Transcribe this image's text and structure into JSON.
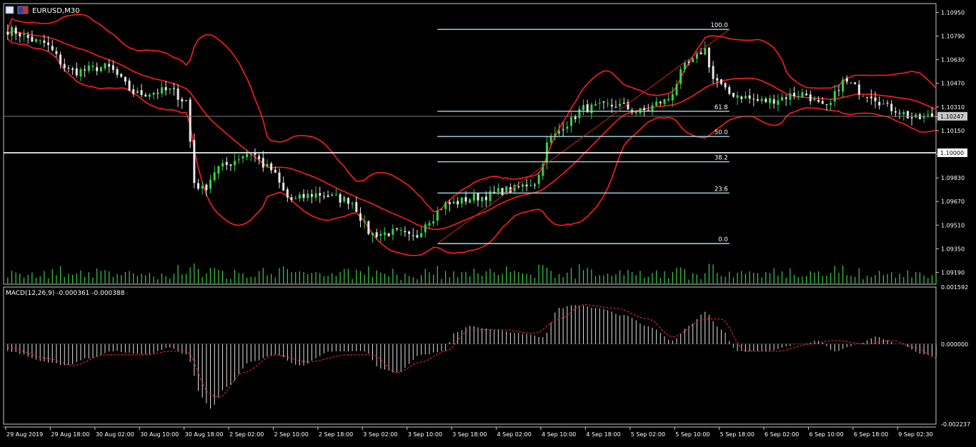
{
  "window": {
    "title": "EURUSD,M30"
  },
  "colors": {
    "background": "#000000",
    "frame": "#c8c8c8",
    "candle_up": "#36d24a",
    "candle_down": "#e8e8e8",
    "bollinger": "#ff1c1c",
    "fibo_line": "#a6dbe6",
    "fibo_trend": "#cc2222",
    "macd_hist": "#e2e2e2",
    "macd_signal": "#ff2a2a",
    "volume": "#36d24a",
    "price_label_bg": "#c8c8c8",
    "text": "#ffffff"
  },
  "chart_data": [
    {
      "type": "candlestick",
      "name": "price",
      "title": "EURUSD,M30",
      "ylim": [
        1.0911,
        1.1101
      ],
      "y_ticks": [
        "1.10950",
        "1.10790",
        "1.10630",
        "1.10470",
        "1.10310",
        "1.10150",
        "1.09990",
        "1.09830",
        "1.09670",
        "1.09510",
        "1.09350",
        "1.09190"
      ],
      "bars": 230,
      "x_ticks": [
        "29 Aug 2019",
        "29 Aug 18:00",
        "30 Aug 02:00",
        "30 Aug 10:00",
        "30 Aug 18:00",
        "2 Sep 02:00",
        "2 Sep 10:00",
        "2 Sep 18:00",
        "3 Sep 02:00",
        "3 Sep 10:00",
        "3 Sep 18:00",
        "4 Sep 02:00",
        "4 Sep 10:00",
        "4 Sep 18:00",
        "5 Sep 02:00",
        "5 Sep 10:00",
        "5 Sep 18:00",
        "6 Sep 02:00",
        "6 Sep 10:00",
        "6 Sep 18:00",
        "9 Sep 02:30"
      ],
      "x_tick_bars": [
        0,
        11,
        22,
        33,
        44,
        55,
        66,
        77,
        88,
        99,
        110,
        121,
        132,
        143,
        154,
        165,
        176,
        187,
        198,
        209,
        220
      ],
      "close_anchors": [
        [
          0,
          1.1083
        ],
        [
          8,
          1.1075
        ],
        [
          16,
          1.1055
        ],
        [
          24,
          1.1058
        ],
        [
          32,
          1.104
        ],
        [
          40,
          1.1042
        ],
        [
          44,
          1.1035
        ],
        [
          46,
          1.098
        ],
        [
          48,
          1.0975
        ],
        [
          52,
          1.099
        ],
        [
          60,
          1.1
        ],
        [
          64,
          1.099
        ],
        [
          70,
          1.0968
        ],
        [
          76,
          1.0972
        ],
        [
          84,
          1.0968
        ],
        [
          90,
          1.0945
        ],
        [
          96,
          1.0946
        ],
        [
          100,
          1.0942
        ],
        [
          104,
          1.0955
        ],
        [
          108,
          1.0965
        ],
        [
          116,
          1.097
        ],
        [
          124,
          1.0975
        ],
        [
          130,
          1.098
        ],
        [
          134,
          1.101
        ],
        [
          138,
          1.102
        ],
        [
          142,
          1.103
        ],
        [
          150,
          1.1032
        ],
        [
          156,
          1.1028
        ],
        [
          162,
          1.1035
        ],
        [
          168,
          1.106
        ],
        [
          172,
          1.107
        ],
        [
          174,
          1.105
        ],
        [
          178,
          1.104
        ],
        [
          186,
          1.1035
        ],
        [
          196,
          1.104
        ],
        [
          202,
          1.103
        ],
        [
          206,
          1.1048
        ],
        [
          212,
          1.104
        ],
        [
          218,
          1.103
        ],
        [
          224,
          1.1023
        ],
        [
          229,
          1.1025
        ]
      ],
      "current_price": "1.10247",
      "level_line": {
        "value": 1.1,
        "label": "1.10000"
      },
      "fibonacci": {
        "high": 1.10835,
        "low": 1.09385,
        "start_bar": 106,
        "end_bar": 178,
        "levels": [
          {
            "ratio": 1.0,
            "label": "100.0"
          },
          {
            "ratio": 0.618,
            "label": "61.8"
          },
          {
            "ratio": 0.5,
            "label": "50.0"
          },
          {
            "ratio": 0.382,
            "label": "38.2"
          },
          {
            "ratio": 0.236,
            "label": "23.6"
          },
          {
            "ratio": 0.0,
            "label": "0.0"
          }
        ]
      },
      "bollinger": {
        "period": 20,
        "deviation": 2
      }
    },
    {
      "type": "bar",
      "name": "macd",
      "title": "MACD(12,26,9) -0.000361 -0.000388",
      "ylim": [
        -0.002237,
        0.001592
      ],
      "y_ticks": [
        "0.001592",
        "0.000000",
        "-0.002237"
      ],
      "hist_anchors": [
        [
          0,
          -0.0002
        ],
        [
          10,
          -0.0005
        ],
        [
          14,
          -0.0006
        ],
        [
          20,
          -0.0004
        ],
        [
          26,
          -0.0002
        ],
        [
          34,
          -0.0003
        ],
        [
          40,
          -0.0001
        ],
        [
          44,
          -0.0003
        ],
        [
          48,
          -0.0015
        ],
        [
          50,
          -0.0018
        ],
        [
          54,
          -0.0012
        ],
        [
          60,
          -0.0005
        ],
        [
          66,
          -0.0003
        ],
        [
          72,
          -0.0006
        ],
        [
          80,
          -0.0002
        ],
        [
          88,
          -0.0002
        ],
        [
          92,
          -0.0007
        ],
        [
          96,
          -0.0008
        ],
        [
          102,
          -0.0003
        ],
        [
          108,
          -0.0002
        ],
        [
          110,
          0.0003
        ],
        [
          114,
          0.0005
        ],
        [
          120,
          0.0004
        ],
        [
          126,
          0.0003
        ],
        [
          132,
          0.0002
        ],
        [
          136,
          0.001
        ],
        [
          140,
          0.0011
        ],
        [
          146,
          0.001
        ],
        [
          152,
          0.0008
        ],
        [
          158,
          0.0005
        ],
        [
          164,
          0.0001
        ],
        [
          168,
          0.0005
        ],
        [
          172,
          0.0009
        ],
        [
          176,
          0.0004
        ],
        [
          180,
          -0.0002
        ],
        [
          186,
          -0.0002
        ],
        [
          196,
          0.0
        ],
        [
          200,
          0.0001
        ],
        [
          204,
          -0.0002
        ],
        [
          210,
          0.0
        ],
        [
          214,
          0.0002
        ],
        [
          220,
          0.0
        ],
        [
          226,
          -0.0003
        ],
        [
          229,
          -0.00036
        ]
      ],
      "signal_anchors": [
        [
          0,
          -0.0001
        ],
        [
          10,
          -0.0004
        ],
        [
          16,
          -0.0006
        ],
        [
          24,
          -0.0003
        ],
        [
          34,
          -0.0003
        ],
        [
          40,
          -0.0002
        ],
        [
          44,
          -0.0002
        ],
        [
          50,
          -0.0014
        ],
        [
          52,
          -0.0015
        ],
        [
          58,
          -0.0008
        ],
        [
          66,
          -0.0003
        ],
        [
          74,
          -0.0005
        ],
        [
          84,
          -0.0003
        ],
        [
          90,
          -0.0003
        ],
        [
          96,
          -0.0008
        ],
        [
          102,
          -0.0005
        ],
        [
          108,
          -0.0002
        ],
        [
          114,
          0.0004
        ],
        [
          122,
          0.0004
        ],
        [
          130,
          0.0003
        ],
        [
          136,
          0.0007
        ],
        [
          142,
          0.0011
        ],
        [
          150,
          0.001
        ],
        [
          158,
          0.0007
        ],
        [
          164,
          0.0002
        ],
        [
          172,
          0.0007
        ],
        [
          176,
          0.0007
        ],
        [
          182,
          -0.0002
        ],
        [
          190,
          -0.0002
        ],
        [
          198,
          0.0
        ],
        [
          204,
          0.0001
        ],
        [
          212,
          0.0
        ],
        [
          218,
          0.0001
        ],
        [
          224,
          -0.0001
        ],
        [
          229,
          -0.00039
        ]
      ]
    }
  ]
}
